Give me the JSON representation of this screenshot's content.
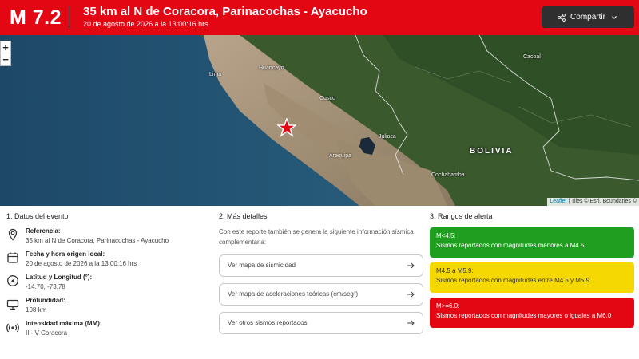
{
  "header": {
    "magnitude": "M 7.2",
    "title": "35 km al N de Coracora, Parinacochas - Ayacucho",
    "datetime": "20 de agosto de 2026 a la 13:00:16 hrs",
    "share_label": "Compartir",
    "color": "#e30613"
  },
  "map": {
    "zoom_in": "+",
    "zoom_out": "−",
    "country": "BOLIVIA",
    "places": [
      {
        "name": "Lima"
      },
      {
        "name": "Huancayo"
      },
      {
        "name": "Cusco"
      },
      {
        "name": "Arequipa"
      },
      {
        "name": "Cochabamba"
      },
      {
        "name": "Cacoal"
      },
      {
        "name": "Juliaca"
      }
    ],
    "attribution_leaflet": "Leaflet",
    "attribution_rest": " | Tiles © Esri, Boundaries ©"
  },
  "section1": {
    "title": "1. Datos del evento",
    "rows": [
      {
        "icon": "location-pin-icon",
        "key": "Referencia:",
        "value": "35 km al N de Coracora, Parinacochas - Ayacucho"
      },
      {
        "icon": "calendar-icon",
        "key": "Fecha y hora origen local:",
        "value": "20 de agosto de 2026 a la 13:00:16 hrs"
      },
      {
        "icon": "compass-icon",
        "key": "Latitud y Longitud (°):",
        "value": "-14.70, -73.78"
      },
      {
        "icon": "depth-icon",
        "key": "Profundidad:",
        "value": "108 km"
      },
      {
        "icon": "intensity-icon",
        "key": "Intensidad máxima (MM):",
        "value": "III-IV Coracora"
      }
    ]
  },
  "section2": {
    "title": "2. Más detalles",
    "intro": "Con este reporte también se genera la siguiente información sísmica complementaria:",
    "links": [
      "Ver mapa de sismicidad",
      "Ver mapa de aceleraciones teóricas (cm/seg²)",
      "Ver otros sismos reportados"
    ]
  },
  "section3": {
    "title": "3. Rangos de alerta",
    "alerts": [
      {
        "range": "M<4.5:",
        "desc": "Sismos reportados con magnitudes menores a M4.5.",
        "color": "#1f9e1f"
      },
      {
        "range": "M4.5 a M5.9:",
        "desc": "Sismos reportados con magnitudes entre M4.5 y M5.9",
        "color": "#f5d800"
      },
      {
        "range": "M>=6.0:",
        "desc": "Sismos reportados con magnitudes mayores o iguales a M6.0",
        "color": "#e30613"
      }
    ]
  }
}
